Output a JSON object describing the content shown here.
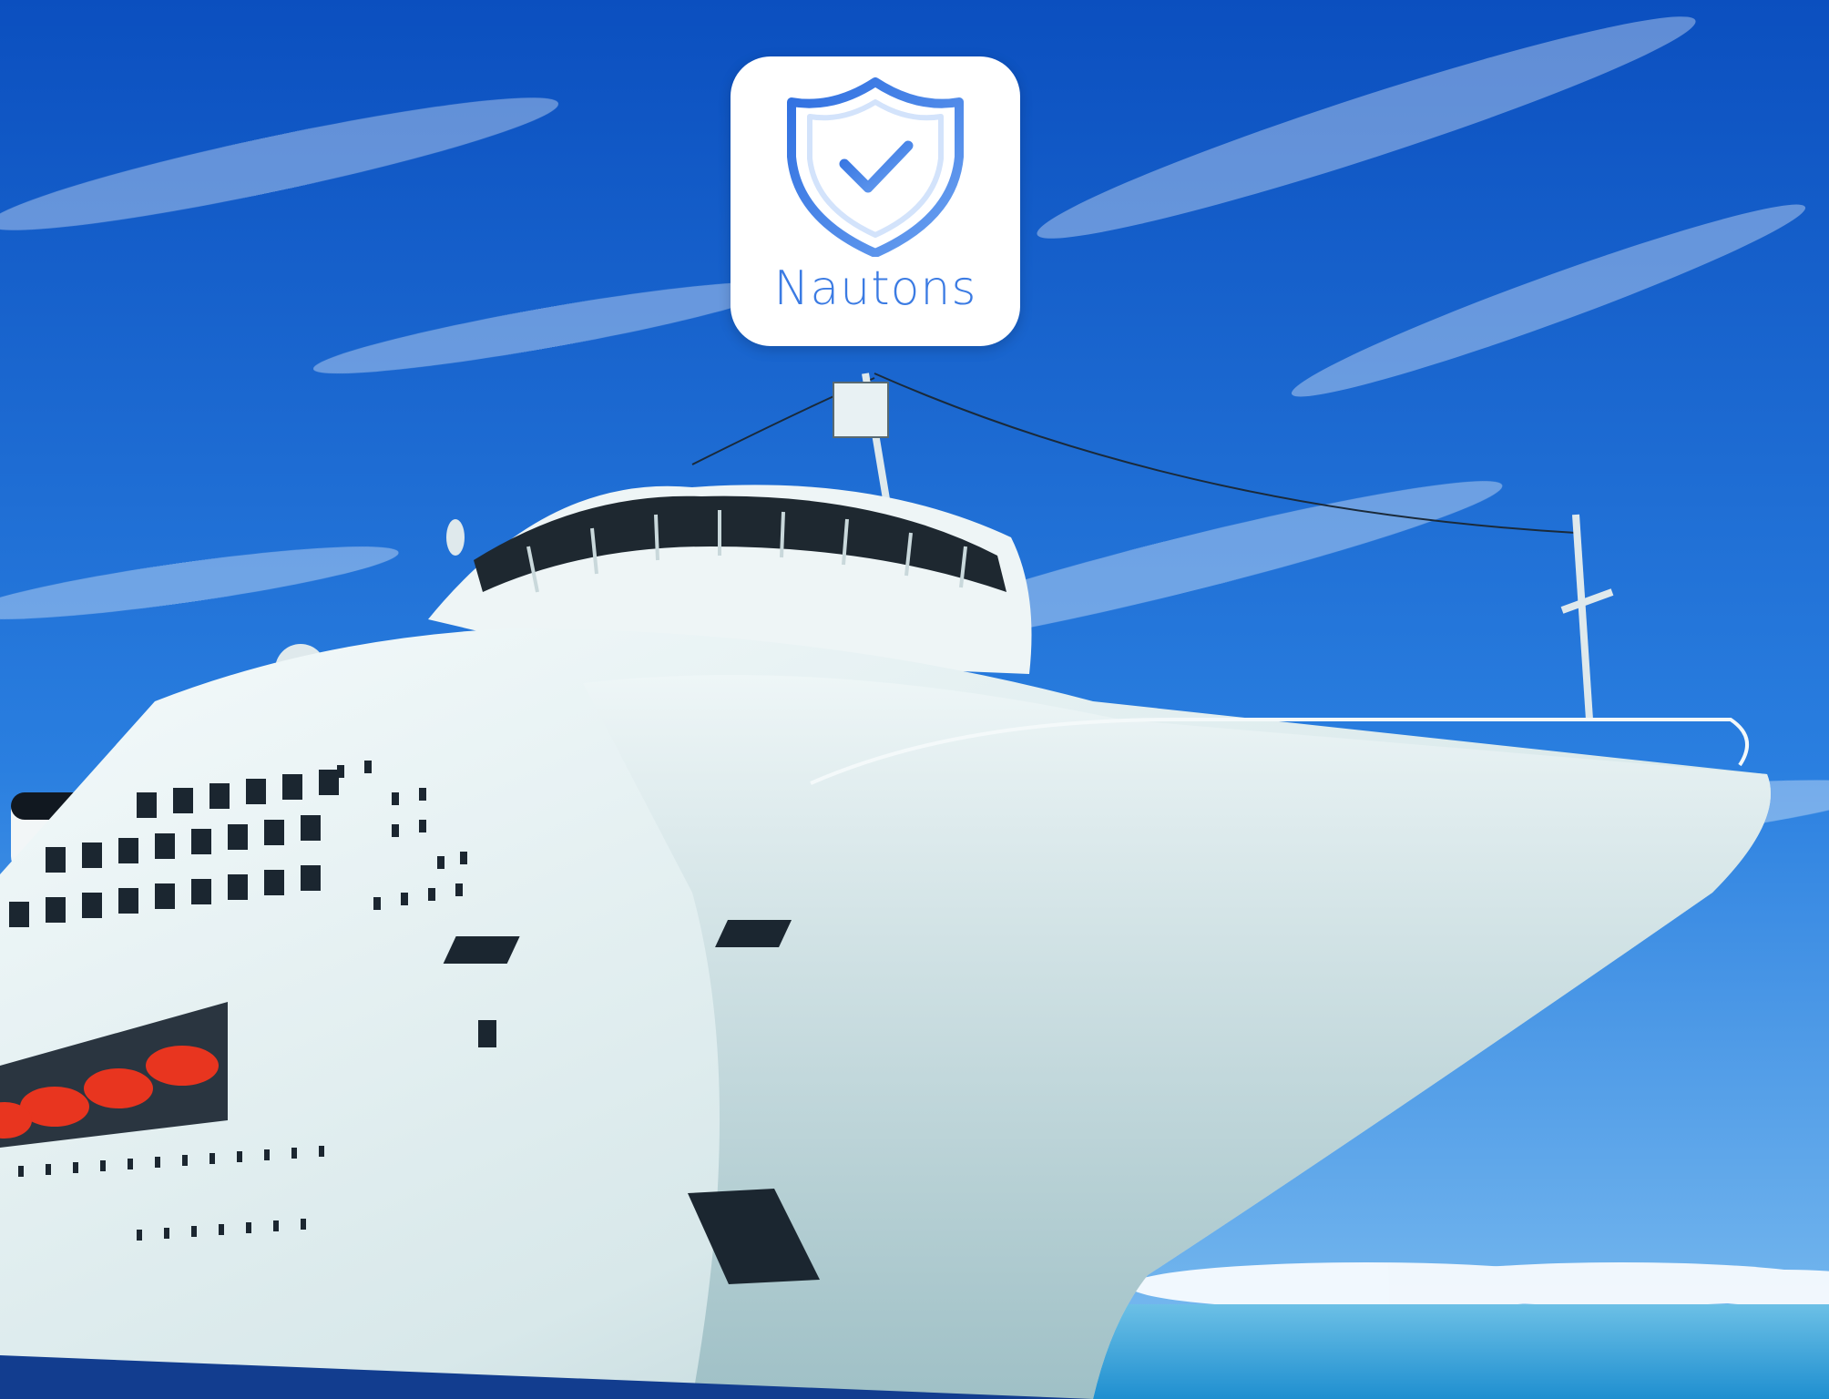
{
  "app_icon": {
    "name": "Nautons",
    "icon": "shield-check-icon",
    "brand_color": "#3b7be3"
  },
  "scene": {
    "subject": "cruise-ship",
    "sky_color": "#1f6ed8",
    "sea_color": "#2b9fd6",
    "hull_color": "#e6f0f1"
  }
}
